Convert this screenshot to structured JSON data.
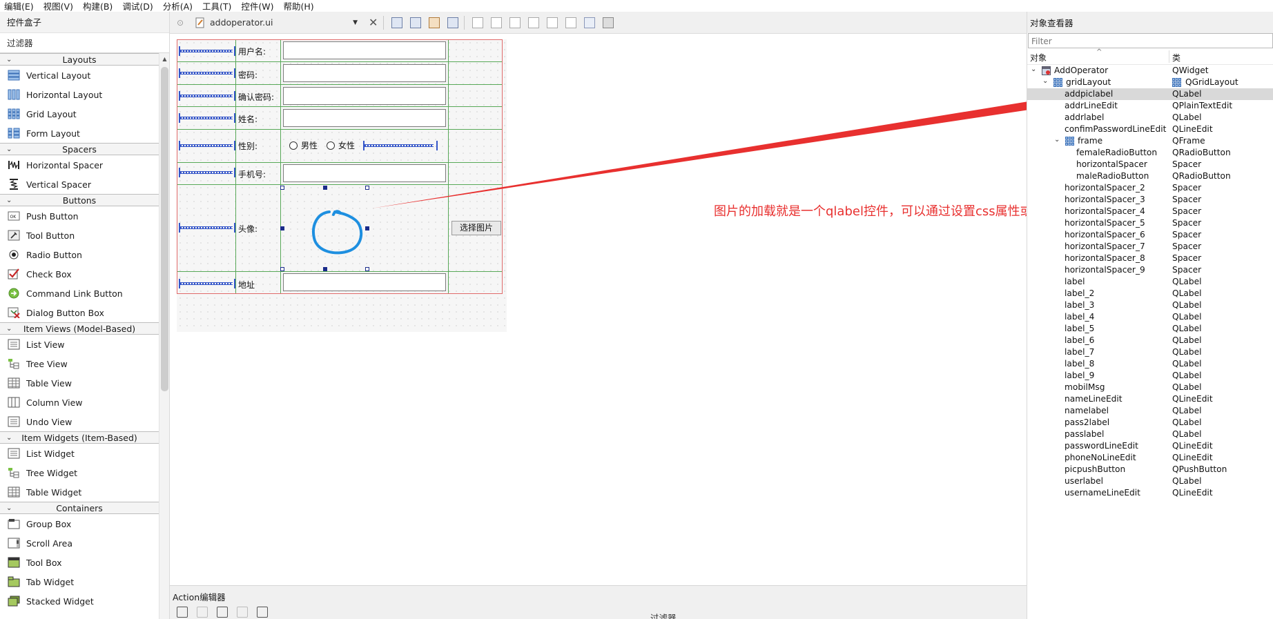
{
  "menubar": {
    "items": [
      "编辑(E)",
      "视图(V)",
      "构建(B)",
      "调试(D)",
      "分析(A)",
      "工具(T)",
      "控件(W)",
      "帮助(H)"
    ]
  },
  "widget_box": {
    "title": "控件盒子",
    "filter": "过滤器",
    "categories": [
      {
        "name": "Layouts",
        "items": [
          "Vertical Layout",
          "Horizontal Layout",
          "Grid Layout",
          "Form Layout"
        ]
      },
      {
        "name": "Spacers",
        "items": [
          "Horizontal Spacer",
          "Vertical Spacer"
        ]
      },
      {
        "name": "Buttons",
        "items": [
          "Push Button",
          "Tool Button",
          "Radio Button",
          "Check Box",
          "Command Link Button",
          "Dialog Button Box"
        ]
      },
      {
        "name": "Item Views (Model-Based)",
        "items": [
          "List View",
          "Tree View",
          "Table View",
          "Column View",
          "Undo View"
        ]
      },
      {
        "name": "Item Widgets (Item-Based)",
        "items": [
          "List Widget",
          "Tree Widget",
          "Table Widget"
        ]
      },
      {
        "name": "Containers",
        "items": [
          "Group Box",
          "Scroll Area",
          "Tool Box",
          "Tab Widget",
          "Stacked Widget"
        ]
      }
    ]
  },
  "editor": {
    "file_name": "addoperator.ui",
    "form": {
      "username_label": "用户名:",
      "password_label": "密码:",
      "confirm_label": "确认密码:",
      "name_label": "姓名:",
      "gender_label": "性别:",
      "male": "男性",
      "female": "女性",
      "phone_label": "手机号:",
      "avatar_label": "头像:",
      "choose_pic_button": "选择图片",
      "address_label": "地址"
    },
    "annotation": "图片的加载就是一个qlabel控件，可以通过设置css属性或代码指定控件来实现"
  },
  "action_editor": {
    "title": "Action编辑器",
    "filter": "过滤器"
  },
  "object_inspector": {
    "title": "对象查看器",
    "filter_placeholder": "Filter",
    "col_object": "对象",
    "col_class": "类",
    "rows": [
      {
        "name": "AddOperator",
        "cls": "QWidget",
        "depth": 0,
        "expand": "v",
        "icon": "widget"
      },
      {
        "name": "gridLayout",
        "cls": "QGridLayout",
        "depth": 1,
        "expand": "v",
        "icon": "grid"
      },
      {
        "name": "addpiclabel",
        "cls": "QLabel",
        "depth": 2,
        "selected": true
      },
      {
        "name": "addrLineEdit",
        "cls": "QPlainTextEdit",
        "depth": 2
      },
      {
        "name": "addrlabel",
        "cls": "QLabel",
        "depth": 2
      },
      {
        "name": "confimPasswordLineEdit",
        "cls": "QLineEdit",
        "depth": 2
      },
      {
        "name": "frame",
        "cls": "QFrame",
        "depth": 2,
        "expand": "v",
        "icon": "grid"
      },
      {
        "name": "femaleRadioButton",
        "cls": "QRadioButton",
        "depth": 3
      },
      {
        "name": "horizontalSpacer",
        "cls": "Spacer",
        "depth": 3
      },
      {
        "name": "maleRadioButton",
        "cls": "QRadioButton",
        "depth": 3
      },
      {
        "name": "horizontalSpacer_2",
        "cls": "Spacer",
        "depth": 2
      },
      {
        "name": "horizontalSpacer_3",
        "cls": "Spacer",
        "depth": 2
      },
      {
        "name": "horizontalSpacer_4",
        "cls": "Spacer",
        "depth": 2
      },
      {
        "name": "horizontalSpacer_5",
        "cls": "Spacer",
        "depth": 2
      },
      {
        "name": "horizontalSpacer_6",
        "cls": "Spacer",
        "depth": 2
      },
      {
        "name": "horizontalSpacer_7",
        "cls": "Spacer",
        "depth": 2
      },
      {
        "name": "horizontalSpacer_8",
        "cls": "Spacer",
        "depth": 2
      },
      {
        "name": "horizontalSpacer_9",
        "cls": "Spacer",
        "depth": 2
      },
      {
        "name": "label",
        "cls": "QLabel",
        "depth": 2
      },
      {
        "name": "label_2",
        "cls": "QLabel",
        "depth": 2
      },
      {
        "name": "label_3",
        "cls": "QLabel",
        "depth": 2
      },
      {
        "name": "label_4",
        "cls": "QLabel",
        "depth": 2
      },
      {
        "name": "label_5",
        "cls": "QLabel",
        "depth": 2
      },
      {
        "name": "label_6",
        "cls": "QLabel",
        "depth": 2
      },
      {
        "name": "label_7",
        "cls": "QLabel",
        "depth": 2
      },
      {
        "name": "label_8",
        "cls": "QLabel",
        "depth": 2
      },
      {
        "name": "label_9",
        "cls": "QLabel",
        "depth": 2
      },
      {
        "name": "mobilMsg",
        "cls": "QLabel",
        "depth": 2
      },
      {
        "name": "nameLineEdit",
        "cls": "QLineEdit",
        "depth": 2
      },
      {
        "name": "namelabel",
        "cls": "QLabel",
        "depth": 2
      },
      {
        "name": "pass2label",
        "cls": "QLabel",
        "depth": 2
      },
      {
        "name": "passlabel",
        "cls": "QLabel",
        "depth": 2
      },
      {
        "name": "passwordLineEdit",
        "cls": "QLineEdit",
        "depth": 2
      },
      {
        "name": "phoneNoLineEdit",
        "cls": "QLineEdit",
        "depth": 2
      },
      {
        "name": "picpushButton",
        "cls": "QPushButton",
        "depth": 2
      },
      {
        "name": "userlabel",
        "cls": "QLabel",
        "depth": 2
      },
      {
        "name": "usernameLineEdit",
        "cls": "QLineEdit",
        "depth": 2
      }
    ]
  },
  "colors": {
    "annotation": "#e8302f",
    "circle": "#1e8fe0",
    "layout_border": "#e06a6a",
    "grid_line": "#57a857",
    "spacer": "#3556c9"
  }
}
